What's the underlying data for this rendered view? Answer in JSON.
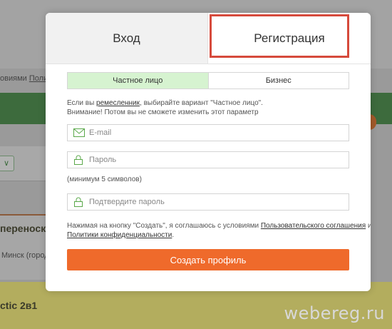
{
  "background": {
    "left_link_text": "овиями",
    "left_link_underlined": "Полити",
    "heading_partial": "переноск",
    "location_partial": "Минск (город",
    "product_partial": "ctic 2в1",
    "select_glyph": "∨",
    "watermark": "webereg.ru"
  },
  "modal": {
    "tabs": {
      "login": "Вход",
      "register": "Регистрация"
    },
    "account_type": {
      "private": "Частное лицо",
      "business": "Бизнес"
    },
    "notice": {
      "line1_prefix": "Если вы ",
      "line1_link": "ремесленник",
      "line1_suffix": ", выбирайте вариант \"Частное лицо\".",
      "line2": "Внимание! Потом вы не сможете изменить этот параметр"
    },
    "email_placeholder": "E-mail",
    "password_placeholder": "Пароль",
    "password_hint": "(минимум 5 символов)",
    "confirm_placeholder": "Подтвердите пароль",
    "terms": {
      "prefix": "Нажимая на кнопку \"Создать\", я соглашаюсь с условиями ",
      "link1": "Пользовательского соглашения",
      "middle": " и",
      "link2": "Политики конфиденциальности",
      "suffix": "."
    },
    "submit_label": "Создать профиль"
  },
  "colors": {
    "accent_orange": "#ef6a2b",
    "selected_segment": "#d6f3d0",
    "highlight_red": "#d64a3c",
    "icon_green": "#5aa84a"
  }
}
